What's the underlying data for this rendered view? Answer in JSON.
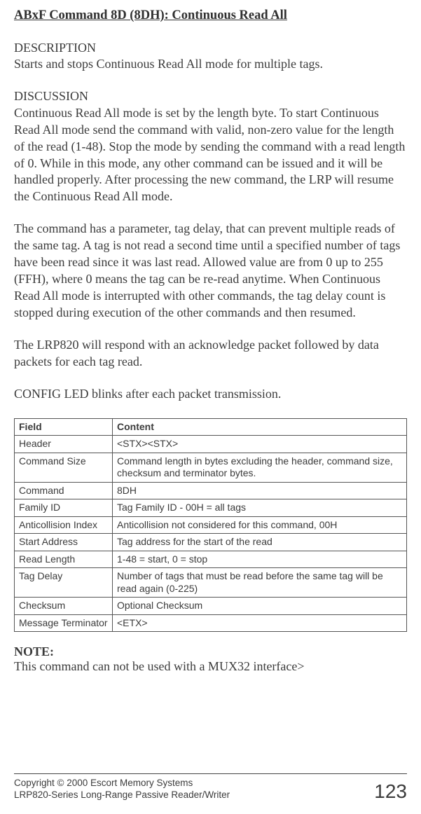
{
  "title": "ABxF Command 8D (8DH): Continuous Read All",
  "description": {
    "label": "DESCRIPTION",
    "text": "Starts and stops Continuous Read All mode for multiple tags."
  },
  "discussion": {
    "label": "DISCUSSION",
    "p1": "Continuous Read All mode is set by the length byte. To start Continuous Read All mode send the command with valid, non-zero value for the length of the read (1-48). Stop the mode by sending the command with a read length of 0. While in this mode, any other command can be issued and it will be handled properly. After processing the new command, the LRP will resume the Continuous Read All mode.",
    "p2": "The command has a parameter, tag delay, that can prevent multiple reads of the same tag.  A tag is not read a second time until a specified number of tags have been read since it was last read. Allowed value are from 0 up to 255 (FFH), where 0 means the tag can be re-read anytime. When Continuous Read All mode is interrupted with other commands, the tag delay count is stopped during execution of the other commands and then resumed.",
    "p3": "The LRP820 will respond with an acknowledge packet followed by data packets for each tag read.",
    "p4": "CONFIG LED blinks after each packet transmission."
  },
  "table": {
    "headers": {
      "field": "Field",
      "content": "Content"
    },
    "rows": [
      {
        "field": "Header",
        "content": "<STX><STX>"
      },
      {
        "field": "Command Size",
        "content": "Command length in bytes excluding the header, command size, checksum and terminator bytes."
      },
      {
        "field": "Command",
        "content": "8DH"
      },
      {
        "field": "Family ID",
        "content": "Tag Family ID - 00H = all tags"
      },
      {
        "field": "Anticollision Index",
        "content": "Anticollision not considered for this command, 00H"
      },
      {
        "field": "Start Address",
        "content": "Tag address for the start of the read"
      },
      {
        "field": "Read Length",
        "content": "1-48 = start, 0 = stop"
      },
      {
        "field": "Tag Delay",
        "content": "Number of tags that must be read before the same tag will be read again (0-225)"
      },
      {
        "field": "Checksum",
        "content": "Optional Checksum"
      },
      {
        "field": "Message Terminator",
        "content": "<ETX>"
      }
    ]
  },
  "note": {
    "label": "NOTE:",
    "text": "This command can not be used with a MUX32 interface>"
  },
  "footer": {
    "line1": "Copyright © 2000 Escort Memory Systems",
    "line2": "LRP820-Series Long-Range Passive Reader/Writer",
    "page": "123"
  }
}
